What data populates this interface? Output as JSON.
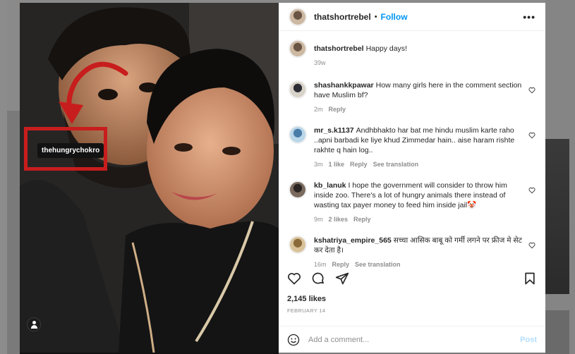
{
  "post": {
    "username": "thatshortrebel",
    "follow_label": "Follow",
    "dot": "•",
    "more_label": "•••",
    "photo_tag": "thehungrychokro"
  },
  "caption": {
    "username": "thatshortrebel",
    "text": "Happy days!",
    "time": "39w"
  },
  "comments": [
    {
      "username": "shashankkpawar",
      "text": "How many girls here in the comment section have Muslim bf?",
      "time": "2m",
      "likes": "",
      "reply": "Reply",
      "translate": ""
    },
    {
      "username": "mr_s.k1137",
      "text": "Andhbhakto har bat me hindu muslim karte raho ..apni barbadi ke liye khud Zimmedar hain.. aise haram rishte rakhte q hain log..",
      "time": "3m",
      "likes": "1 like",
      "reply": "Reply",
      "translate": "See translation"
    },
    {
      "username": "kb_lanuk",
      "text": "I hope the government will consider to throw him inside zoo. There's a lot of hungry animals there instead of wasting tax payer money to feed him inside jail🤡",
      "time": "9m",
      "likes": "2 likes",
      "reply": "Reply",
      "translate": ""
    },
    {
      "username": "kshatriya_empire_565",
      "text": "सच्चा आसिक बाबू को गर्मी लगने पर फ्रीज मे सेट कर देता है।",
      "time": "16m",
      "likes": "",
      "reply": "Reply",
      "translate": "See translation"
    }
  ],
  "footer": {
    "likes": "2,145 likes",
    "date": "FEBRUARY 14",
    "add_comment_placeholder": "Add a comment...",
    "post_label": "Post"
  },
  "colors": {
    "accent": "#0095f6",
    "tag_border": "#c81d1d",
    "arrow": "#c81d1d"
  }
}
